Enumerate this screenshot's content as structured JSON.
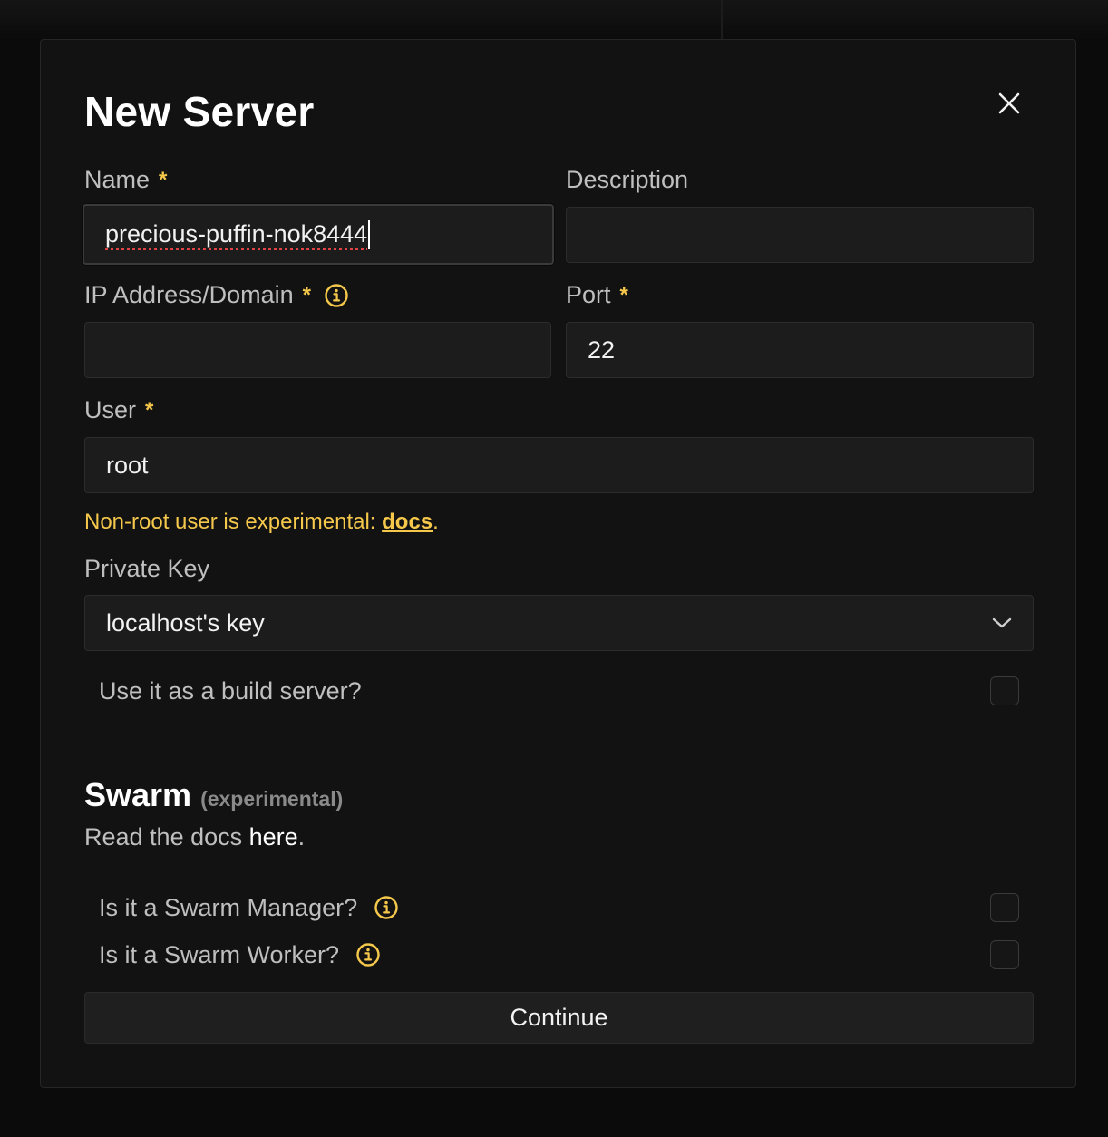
{
  "dialog": {
    "title": "New Server"
  },
  "fields": {
    "name": {
      "label": "Name",
      "required_mark": "*",
      "value": "precious-puffin-nok8444"
    },
    "description": {
      "label": "Description",
      "value": ""
    },
    "ip": {
      "label": "IP Address/Domain",
      "required_mark": "*",
      "value": ""
    },
    "port": {
      "label": "Port",
      "required_mark": "*",
      "value": "22"
    },
    "user": {
      "label": "User",
      "required_mark": "*",
      "value": "root"
    },
    "private_key": {
      "label": "Private Key",
      "selected": "localhost's key"
    }
  },
  "warning": {
    "text": "Non-root user is experimental: ",
    "link": "docs",
    "suffix": "."
  },
  "build_server": {
    "label": "Use it as a build server?",
    "checked": false
  },
  "swarm": {
    "title": "Swarm",
    "tag": "(experimental)",
    "docs_prefix": "Read the docs ",
    "docs_link": "here",
    "docs_suffix": ".",
    "manager": {
      "label": "Is it a Swarm Manager?",
      "checked": false
    },
    "worker": {
      "label": "Is it a Swarm Worker?",
      "checked": false
    }
  },
  "actions": {
    "continue": "Continue"
  },
  "colors": {
    "accent": "#f5c84c",
    "background": "#121212",
    "input_bg": "#1c1c1c"
  },
  "icons": {
    "close": "close-icon",
    "info": "info-icon",
    "select": "chevron-down-icon"
  }
}
